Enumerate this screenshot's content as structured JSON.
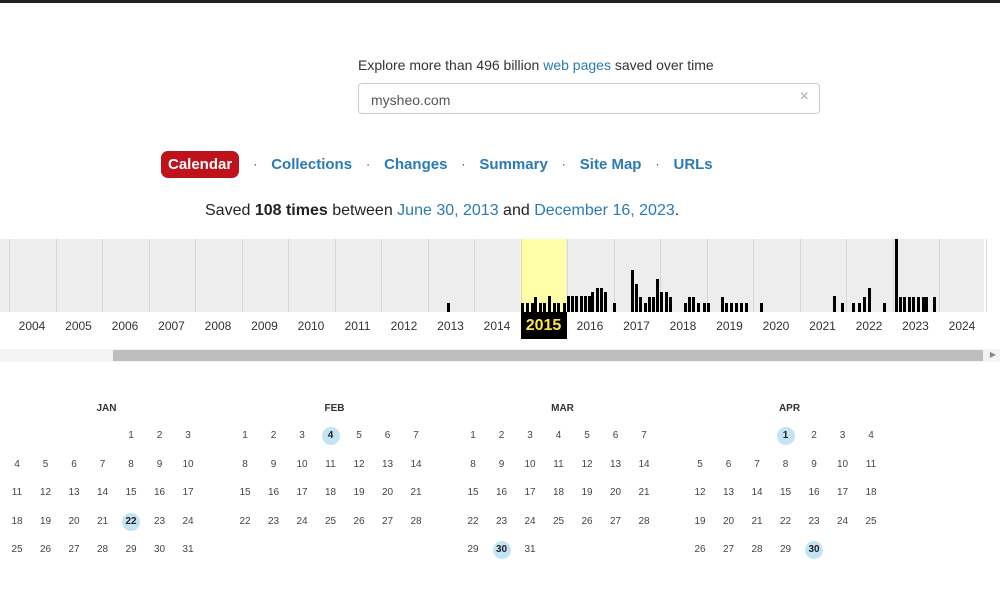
{
  "header": {
    "explore_prefix": "Explore more than 496 billion",
    "explore_link": "web pages",
    "explore_suffix": "saved over time"
  },
  "search": {
    "value": "mysheo.com",
    "clear_icon": "×"
  },
  "tabs": [
    {
      "label": "Calendar",
      "active": true
    },
    {
      "label": "Collections"
    },
    {
      "label": "Changes"
    },
    {
      "label": "Summary"
    },
    {
      "label": "Site Map"
    },
    {
      "label": "URLs"
    }
  ],
  "separator": "·",
  "summary": {
    "prefix": "Saved",
    "count": "108 times",
    "middle": "between",
    "start": "June 30, 2013",
    "and": "and",
    "end": "December 16, 2023",
    "end_punct": "."
  },
  "timeline": {
    "years": [
      "2004",
      "2005",
      "2006",
      "2007",
      "2008",
      "2009",
      "2010",
      "2011",
      "2012",
      "2013",
      "2014",
      "2015",
      "2016",
      "2017",
      "2018",
      "2019",
      "2020",
      "2021",
      "2022",
      "2023",
      "2024"
    ],
    "selected_year": "2015",
    "colors": {
      "highlight": "#ffffa8",
      "bar": "#000000",
      "selected_bg": "#000000",
      "selected_text": "#ffe34c"
    }
  },
  "calendar": {
    "highlight_color": "#c2e4f4",
    "months": [
      {
        "name": "JAN",
        "weeks": [
          [
            "",
            "",
            "",
            "",
            "1",
            "2",
            "3"
          ],
          [
            "4",
            "5",
            "6",
            "7",
            "8",
            "9",
            "10"
          ],
          [
            "11",
            "12",
            "13",
            "14",
            "15",
            "16",
            "17"
          ],
          [
            "18",
            "19",
            "20",
            "21",
            "22",
            "23",
            "24"
          ],
          [
            "25",
            "26",
            "27",
            "28",
            "29",
            "30",
            "31"
          ]
        ],
        "highlighted": [
          "22"
        ]
      },
      {
        "name": "FEB",
        "weeks": [
          [
            "1",
            "2",
            "3",
            "4",
            "5",
            "6",
            "7"
          ],
          [
            "8",
            "9",
            "10",
            "11",
            "12",
            "13",
            "14"
          ],
          [
            "15",
            "16",
            "17",
            "18",
            "19",
            "20",
            "21"
          ],
          [
            "22",
            "23",
            "24",
            "25",
            "26",
            "27",
            "28"
          ]
        ],
        "highlighted": [
          "4"
        ]
      },
      {
        "name": "MAR",
        "weeks": [
          [
            "1",
            "2",
            "3",
            "4",
            "5",
            "6",
            "7"
          ],
          [
            "8",
            "9",
            "10",
            "11",
            "12",
            "13",
            "14"
          ],
          [
            "15",
            "16",
            "17",
            "18",
            "19",
            "20",
            "21"
          ],
          [
            "22",
            "23",
            "24",
            "25",
            "26",
            "27",
            "28"
          ],
          [
            "29",
            "30",
            "31",
            "",
            "",
            "",
            ""
          ]
        ],
        "highlighted": [
          "30"
        ]
      },
      {
        "name": "APR",
        "weeks": [
          [
            "",
            "",
            "",
            "1",
            "2",
            "3",
            "4"
          ],
          [
            "5",
            "6",
            "7",
            "8",
            "9",
            "10",
            "11"
          ],
          [
            "12",
            "13",
            "14",
            "15",
            "16",
            "17",
            "18"
          ],
          [
            "19",
            "20",
            "21",
            "22",
            "23",
            "24",
            "25"
          ],
          [
            "26",
            "27",
            "28",
            "29",
            "30",
            "",
            ""
          ]
        ],
        "highlighted": [
          "1",
          "30"
        ]
      }
    ]
  }
}
